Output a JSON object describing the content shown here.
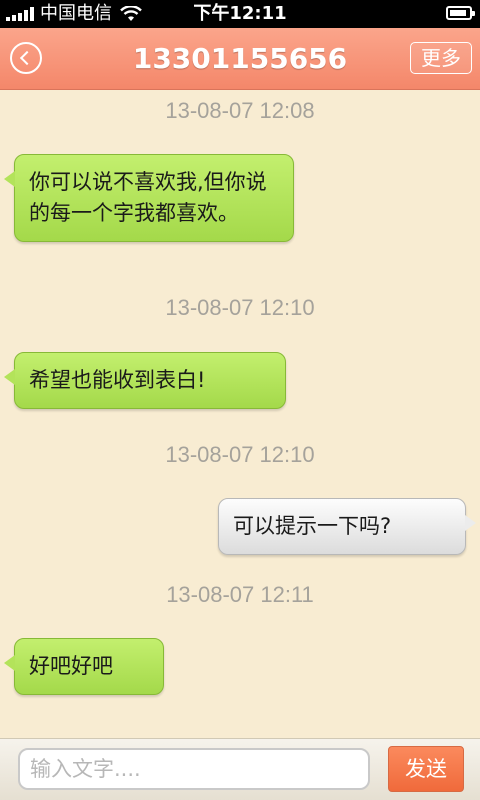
{
  "status_bar": {
    "carrier": "中国电信",
    "time": "下午12:11"
  },
  "header": {
    "title": "13301155656",
    "back_icon": "back-circle-icon",
    "more_label": "更多"
  },
  "messages": [
    {
      "timestamp": "13-08-07 12:08",
      "direction": "incoming",
      "text": "你可以说不喜欢我,但你说的每一个字我都喜欢。"
    },
    {
      "timestamp": "13-08-07 12:10",
      "direction": "incoming",
      "text": "希望也能收到表白!"
    },
    {
      "timestamp": "13-08-07 12:10",
      "direction": "outgoing",
      "text": "可以提示一下吗?"
    },
    {
      "timestamp": "13-08-07 12:11",
      "direction": "incoming",
      "text": "好吧好吧"
    }
  ],
  "composer": {
    "placeholder": "输入文字....",
    "value": "",
    "send_label": "发送"
  },
  "colors": {
    "header": "#f79277",
    "incoming_bubble": "#b3e35a",
    "outgoing_bubble": "#ececec",
    "background": "#f8ecd2",
    "send_button": "#f37a4b"
  }
}
